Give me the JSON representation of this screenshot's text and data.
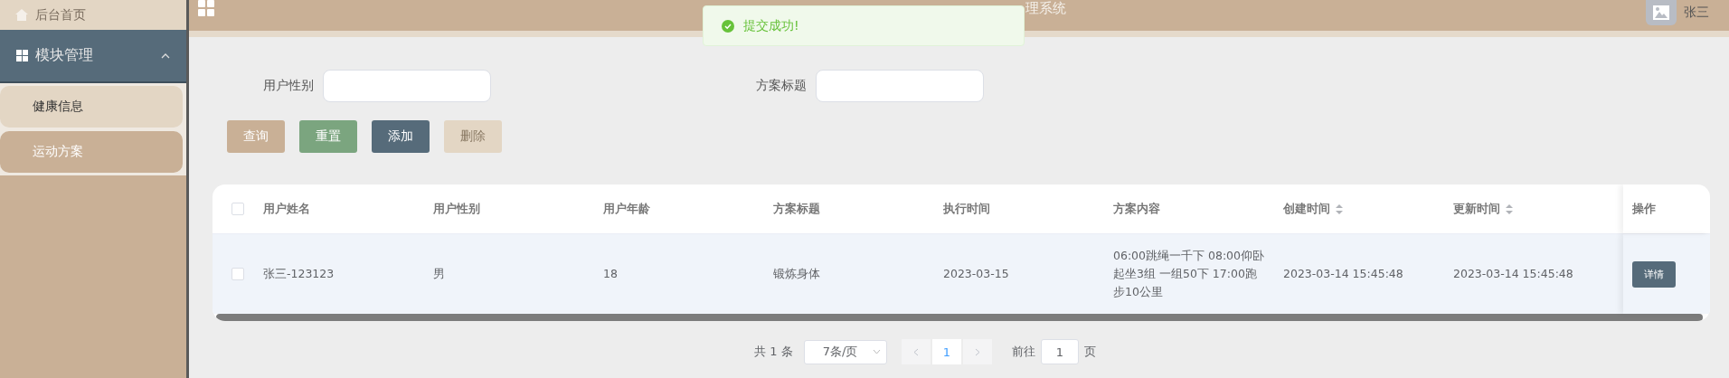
{
  "header": {
    "title": "理系统",
    "user": "张三"
  },
  "toast": {
    "message": "提交成功!"
  },
  "sidebar": {
    "items": [
      {
        "label": "后台首页",
        "kind": "link"
      },
      {
        "label": "模块管理",
        "kind": "group",
        "expanded": true,
        "children": [
          {
            "label": "健康信息",
            "selected": false
          },
          {
            "label": "运动方案",
            "selected": true
          }
        ]
      }
    ]
  },
  "filters": [
    {
      "label": "用户性别"
    },
    {
      "label": "方案标题"
    }
  ],
  "buttons": [
    {
      "label": "查询",
      "kind": "search",
      "disabled": false
    },
    {
      "label": "重置",
      "kind": "reset",
      "disabled": false
    },
    {
      "label": "添加",
      "kind": "add",
      "disabled": false
    },
    {
      "label": "删除",
      "kind": "delete",
      "disabled": true
    }
  ],
  "table": {
    "select_all_checked": false,
    "columns": [
      {
        "label": "用户姓名",
        "sortable": false
      },
      {
        "label": "用户性别",
        "sortable": false
      },
      {
        "label": "用户年龄",
        "sortable": false
      },
      {
        "label": "方案标题",
        "sortable": false
      },
      {
        "label": "执行时间",
        "sortable": false
      },
      {
        "label": "方案内容",
        "sortable": false
      },
      {
        "label": "创建时间",
        "sortable": true
      },
      {
        "label": "更新时间",
        "sortable": true
      }
    ],
    "action_column": "操作",
    "rows": [
      {
        "checked": false,
        "cells": [
          "张三-123123",
          "男",
          "18",
          "锻炼身体",
          "2023-03-15",
          "06:00跳绳一千下 08:00仰卧起坐3组 一组50下 17:00跑步10公里",
          "2023-03-14 15:45:48",
          "2023-03-14 15:45:48"
        ],
        "action": "详情"
      }
    ]
  },
  "pagination": {
    "total": "共 1 条",
    "page_size": "7条/页",
    "pages": [
      {
        "label": "1",
        "selected": true
      }
    ],
    "goto_label": "前往",
    "goto_value": "1",
    "page_suffix": "页"
  }
}
